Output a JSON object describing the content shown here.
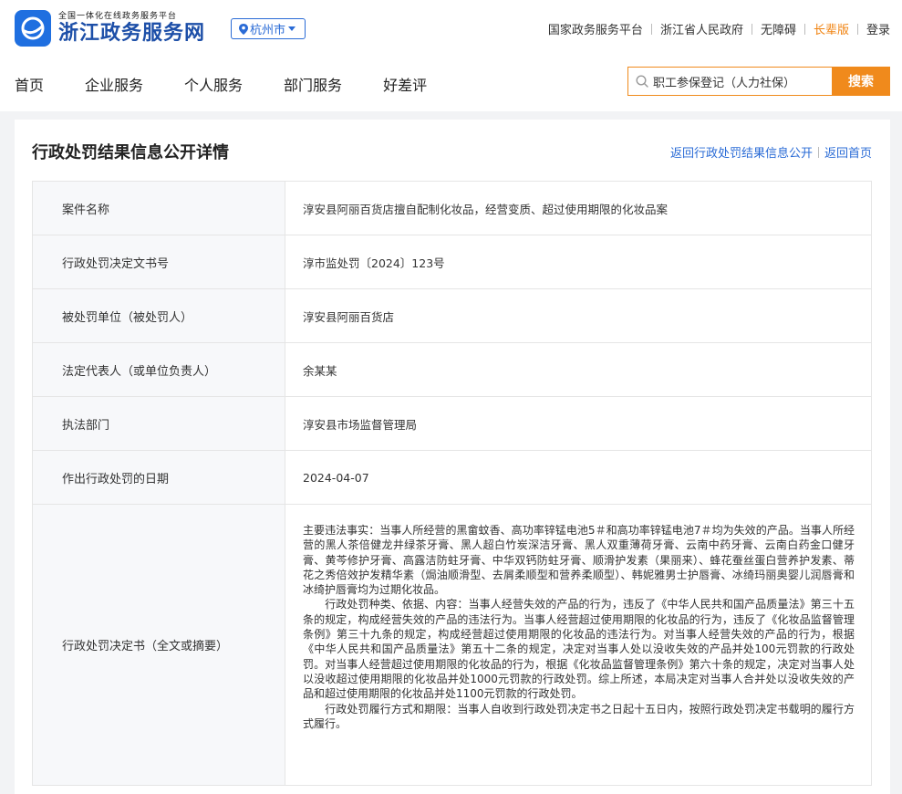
{
  "header": {
    "logo_small": "全国一体化在线政务服务平台",
    "logo_big": "浙江政务服务网",
    "city": "杭州市",
    "top_links": [
      "国家政务服务平台",
      "浙江省人民政府",
      "无障碍",
      "长辈版",
      "登录"
    ]
  },
  "nav": {
    "items": [
      "首页",
      "企业服务",
      "个人服务",
      "部门服务",
      "好差评"
    ]
  },
  "search": {
    "placeholder": "职工参保登记（人力社保）",
    "button": "搜索"
  },
  "detail": {
    "title": "行政处罚结果信息公开详情",
    "back_list": "返回行政处罚结果信息公开",
    "back_home": "返回首页",
    "rows": [
      {
        "label": "案件名称",
        "value": "淳安县阿丽百货店擅自配制化妆品，经营变质、超过使用期限的化妆品案"
      },
      {
        "label": "行政处罚决定文书号",
        "value": "淳市监处罚〔2024〕123号"
      },
      {
        "label": "被处罚单位（被处罚人）",
        "value": "淳安县阿丽百货店"
      },
      {
        "label": "法定代表人（或单位负责人）",
        "value": "余某某"
      },
      {
        "label": "执法部门",
        "value": "淳安县市场监督管理局"
      },
      {
        "label": "作出行政处罚的日期",
        "value": "2024-04-07"
      }
    ],
    "decision": {
      "label": "行政处罚决定书（全文或摘要）",
      "paragraphs": [
        "主要违法事实：当事人所经营的黑畲蚊香、高功率锌锰电池5＃和高功率锌锰电池7＃均为失效的产品。当事人所经营的黑人茶倍健龙井绿茶牙膏、黑人超白竹炭深洁牙膏、黑人双重薄荷牙膏、云南中药牙膏、云南白药金口健牙膏、黄芩修护牙膏、高露洁防蛀牙膏、中华双钙防蛀牙膏、顺滑护发素（果丽来）、蜂花蚕丝蛋白营养护发素、蒂花之秀倍效护发精华素（焗油顺滑型、去屑柔顺型和营养柔顺型）、韩妮雅男士护唇膏、冰绮玛丽奥婴儿润唇膏和冰绮护唇膏均为过期化妆品。",
        "　　行政处罚种类、依据、内容：当事人经营失效的产品的行为，违反了《中华人民共和国产品质量法》第三十五条的规定，构成经营失效的产品的违法行为。当事人经营超过使用期限的化妆品的行为，违反了《化妆品监督管理条例》第三十九条的规定，构成经营超过使用期限的化妆品的违法行为。对当事人经营失效的产品的行为，根据《中华人民共和国产品质量法》第五十二条的规定，决定对当事人处以没收失效的产品并处100元罚款的行政处罚。对当事人经营超过使用期限的化妆品的行为，根据《化妆品监督管理条例》第六十条的规定，决定对当事人处以没收超过使用期限的化妆品并处1000元罚款的行政处罚。综上所述，本局决定对当事人合并处以没收失效的产品和超过使用期限的化妆品并处1100元罚款的行政处罚。",
        "　　行政处罚履行方式和期限：当事人自收到行政处罚决定书之日起十五日内，按照行政处罚决定书载明的履行方式履行。"
      ]
    }
  }
}
